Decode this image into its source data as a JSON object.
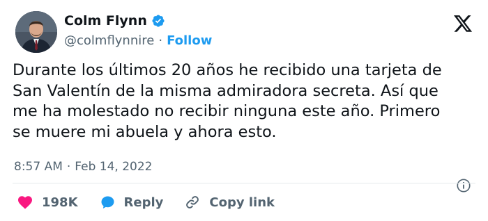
{
  "author": {
    "display_name": "Colm Flynn",
    "handle": "@colmflynnire",
    "follow_label": "Follow"
  },
  "tweet": {
    "text": "Durante los últimos 20 años he recibido una tarjeta de\nSan Valentín de la misma admiradora secreta. Así que\nme ha molestado no recibir ninguna este año. Primero\nse muere mi abuela y ahora esto.",
    "time": "8:57 AM",
    "date": "Feb 14, 2022"
  },
  "actions": {
    "likes": "198K",
    "reply_label": "Reply",
    "copy_link_label": "Copy link"
  },
  "icons": {
    "verified": "verified-badge-icon",
    "logo": "x-logo-icon",
    "info": "info-icon",
    "like": "heart-icon",
    "reply": "reply-bubble-icon",
    "link": "link-icon"
  },
  "colors": {
    "accent": "#1d9bf0",
    "like": "#f91880",
    "text": "#0f1419",
    "secondary": "#536471"
  }
}
